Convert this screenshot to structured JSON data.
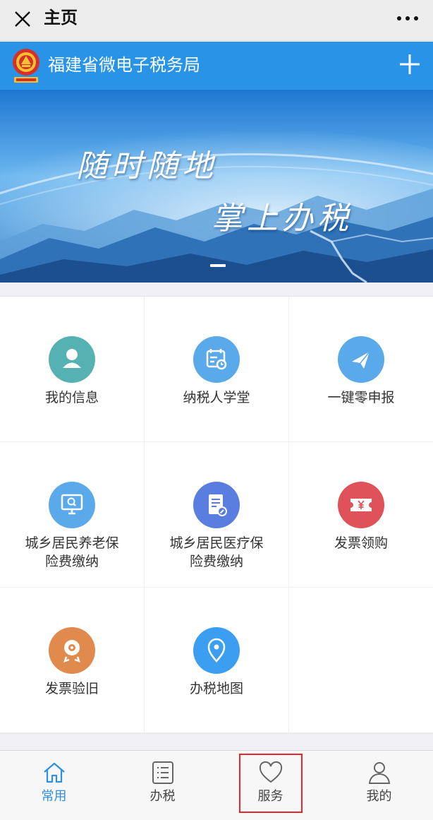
{
  "window": {
    "title": "主页",
    "close_icon": "close-icon",
    "more_icon": "more-options-icon"
  },
  "header": {
    "title": "福建省微电子税务局",
    "emblem_icon": "tax-emblem-icon",
    "plus_icon": "plus-icon",
    "color": "#2993e8"
  },
  "banner": {
    "line1": "随时随地",
    "line2": "掌上办税",
    "slides": 1
  },
  "services": [
    {
      "label": "我的信息",
      "icon": "user-icon",
      "color": "#56b1b2"
    },
    {
      "label": "纳税人学堂",
      "icon": "calendar-clock-icon",
      "color": "#5aa9ea"
    },
    {
      "label": "一键零申报",
      "icon": "paper-plane-icon",
      "color": "#5aa9ea"
    },
    {
      "label": "城乡居民养老保\n险费缴纳",
      "icon": "monitor-search-icon",
      "color": "#5aa9ea"
    },
    {
      "label": "城乡居民医疗保\n险费缴纳",
      "icon": "document-edit-icon",
      "color": "#5a7de0"
    },
    {
      "label": "发票领购",
      "icon": "yen-ticket-icon",
      "color": "#e0525a"
    },
    {
      "label": "发票验旧",
      "icon": "seal-stamp-icon",
      "color": "#e08a4e"
    },
    {
      "label": "办税地图",
      "icon": "map-pin-icon",
      "color": "#3b9ef0"
    }
  ],
  "tabs": [
    {
      "label": "常用",
      "icon": "home-icon",
      "active": true
    },
    {
      "label": "办税",
      "icon": "list-icon",
      "active": false
    },
    {
      "label": "服务",
      "icon": "heart-icon",
      "active": false
    },
    {
      "label": "我的",
      "icon": "person-icon",
      "active": false
    }
  ]
}
